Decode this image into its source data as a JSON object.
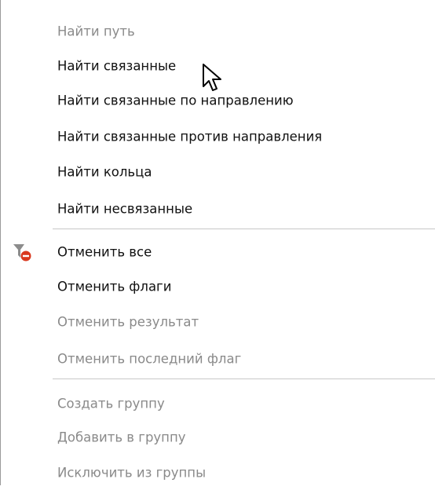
{
  "menu": {
    "items": [
      {
        "label": "Найти путь",
        "enabled": false
      },
      {
        "label": "Найти связанные",
        "enabled": true
      },
      {
        "label": "Найти связанные по направлению",
        "enabled": true
      },
      {
        "label": "Найти связанные против направления",
        "enabled": true
      },
      {
        "label": "Найти кольца",
        "enabled": true
      },
      {
        "label": "Найти несвязанные",
        "enabled": true
      },
      {
        "label": "Отменить все",
        "enabled": true,
        "icon": "clear-filter-icon"
      },
      {
        "label": "Отменить флаги",
        "enabled": true
      },
      {
        "label": "Отменить результат",
        "enabled": false
      },
      {
        "label": "Отменить последний флаг",
        "enabled": false
      },
      {
        "label": "Создать группу",
        "enabled": false
      },
      {
        "label": "Добавить в группу",
        "enabled": false
      },
      {
        "label": "Исключить из группы",
        "enabled": false
      }
    ]
  },
  "colors": {
    "enabled_text": "#111111",
    "disabled_text": "#8a8a8a",
    "separator": "#c8c8c8",
    "icon_gray": "#8c8c8c",
    "icon_red": "#d9381e"
  }
}
